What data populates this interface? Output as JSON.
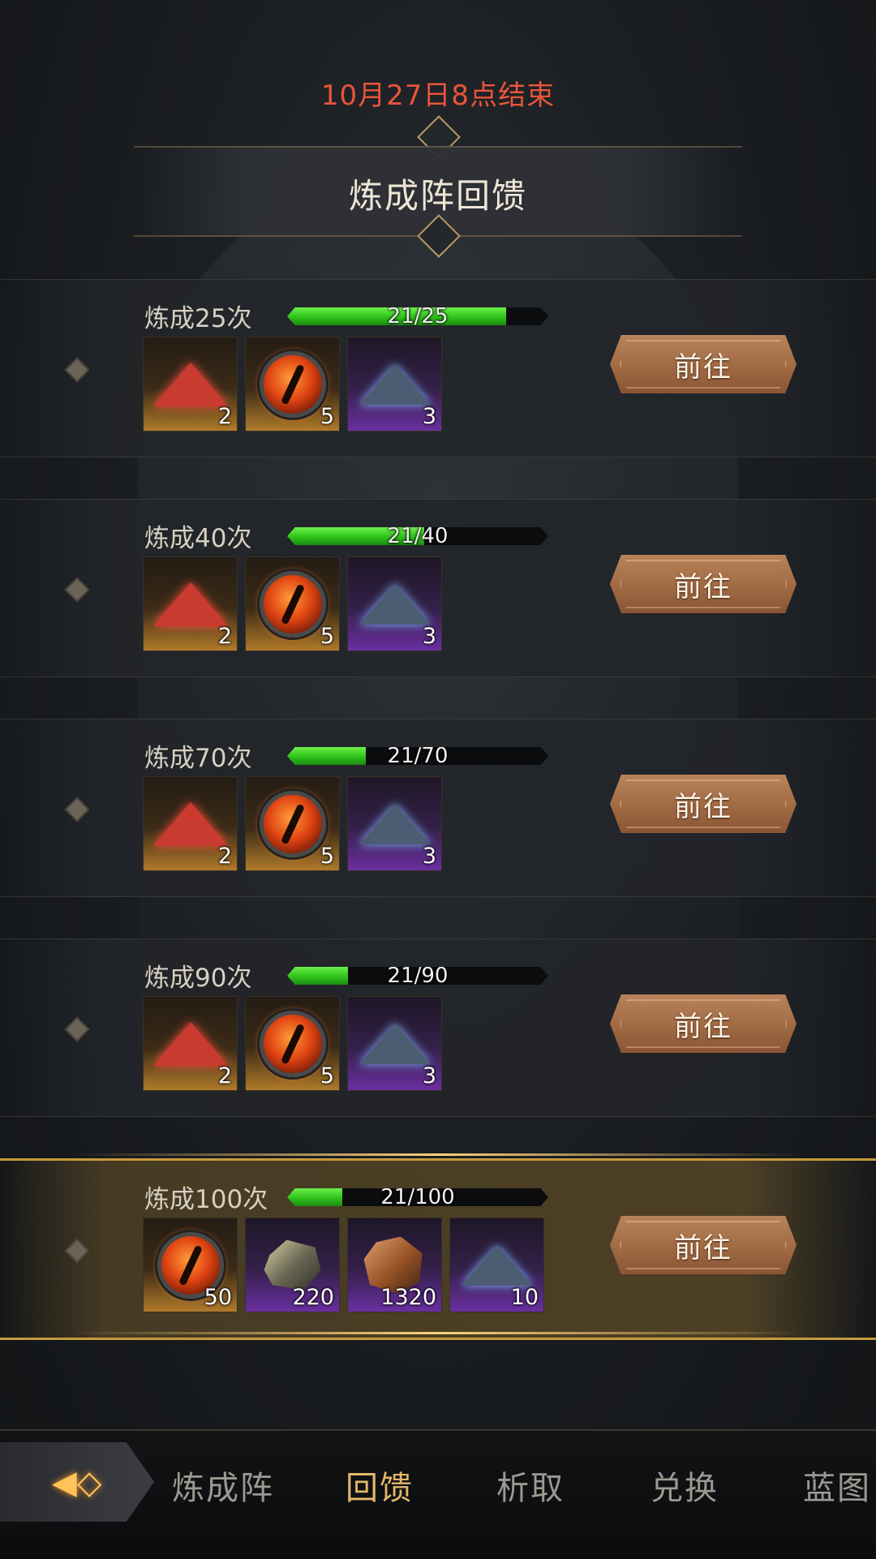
{
  "header": {
    "end_time": "10月27日8点结束",
    "title": "炼成阵回馈"
  },
  "rewards": [
    {
      "title": "炼成25次",
      "progress_text": "21/25",
      "progress": 0.84,
      "button": "前往",
      "items": [
        {
          "icon": "red-powder-icon",
          "rarity": "orange",
          "qty": "2"
        },
        {
          "icon": "fire-eye-icon",
          "rarity": "orange",
          "qty": "5"
        },
        {
          "icon": "blue-powder-icon",
          "rarity": "purple",
          "qty": "3"
        }
      ]
    },
    {
      "title": "炼成40次",
      "progress_text": "21/40",
      "progress": 0.525,
      "button": "前往",
      "items": [
        {
          "icon": "red-powder-icon",
          "rarity": "orange",
          "qty": "2"
        },
        {
          "icon": "fire-eye-icon",
          "rarity": "orange",
          "qty": "5"
        },
        {
          "icon": "blue-powder-icon",
          "rarity": "purple",
          "qty": "3"
        }
      ]
    },
    {
      "title": "炼成70次",
      "progress_text": "21/70",
      "progress": 0.3,
      "button": "前往",
      "items": [
        {
          "icon": "red-powder-icon",
          "rarity": "orange",
          "qty": "2"
        },
        {
          "icon": "fire-eye-icon",
          "rarity": "orange",
          "qty": "5"
        },
        {
          "icon": "blue-powder-icon",
          "rarity": "purple",
          "qty": "3"
        }
      ]
    },
    {
      "title": "炼成90次",
      "progress_text": "21/90",
      "progress": 0.233,
      "button": "前往",
      "items": [
        {
          "icon": "red-powder-icon",
          "rarity": "orange",
          "qty": "2"
        },
        {
          "icon": "fire-eye-icon",
          "rarity": "orange",
          "qty": "5"
        },
        {
          "icon": "blue-powder-icon",
          "rarity": "purple",
          "qty": "3"
        }
      ]
    },
    {
      "title": "炼成100次",
      "progress_text": "21/100",
      "progress": 0.21,
      "button": "前往",
      "highlight": true,
      "items": [
        {
          "icon": "fire-eye-icon",
          "rarity": "orange",
          "qty": "50"
        },
        {
          "icon": "gray-ore-icon",
          "rarity": "purple",
          "qty": "220"
        },
        {
          "icon": "brown-ore-icon",
          "rarity": "purple",
          "qty": "1320"
        },
        {
          "icon": "blue-powder-icon",
          "rarity": "purple",
          "qty": "10"
        }
      ]
    }
  ],
  "nav": {
    "back_icon": "back-arrow-icon",
    "tabs": [
      {
        "label": "炼成阵",
        "active": false
      },
      {
        "label": "回馈",
        "active": true
      },
      {
        "label": "析取",
        "active": false
      },
      {
        "label": "兑换",
        "active": false
      },
      {
        "label": "蓝图",
        "active": false
      }
    ]
  },
  "colors": {
    "end_time": "#e8553a",
    "progress_green": "#2fc21c",
    "button_brown": "#a26c45",
    "active_tab": "#e2b76a",
    "highlight_gold": "#c69a3c"
  }
}
